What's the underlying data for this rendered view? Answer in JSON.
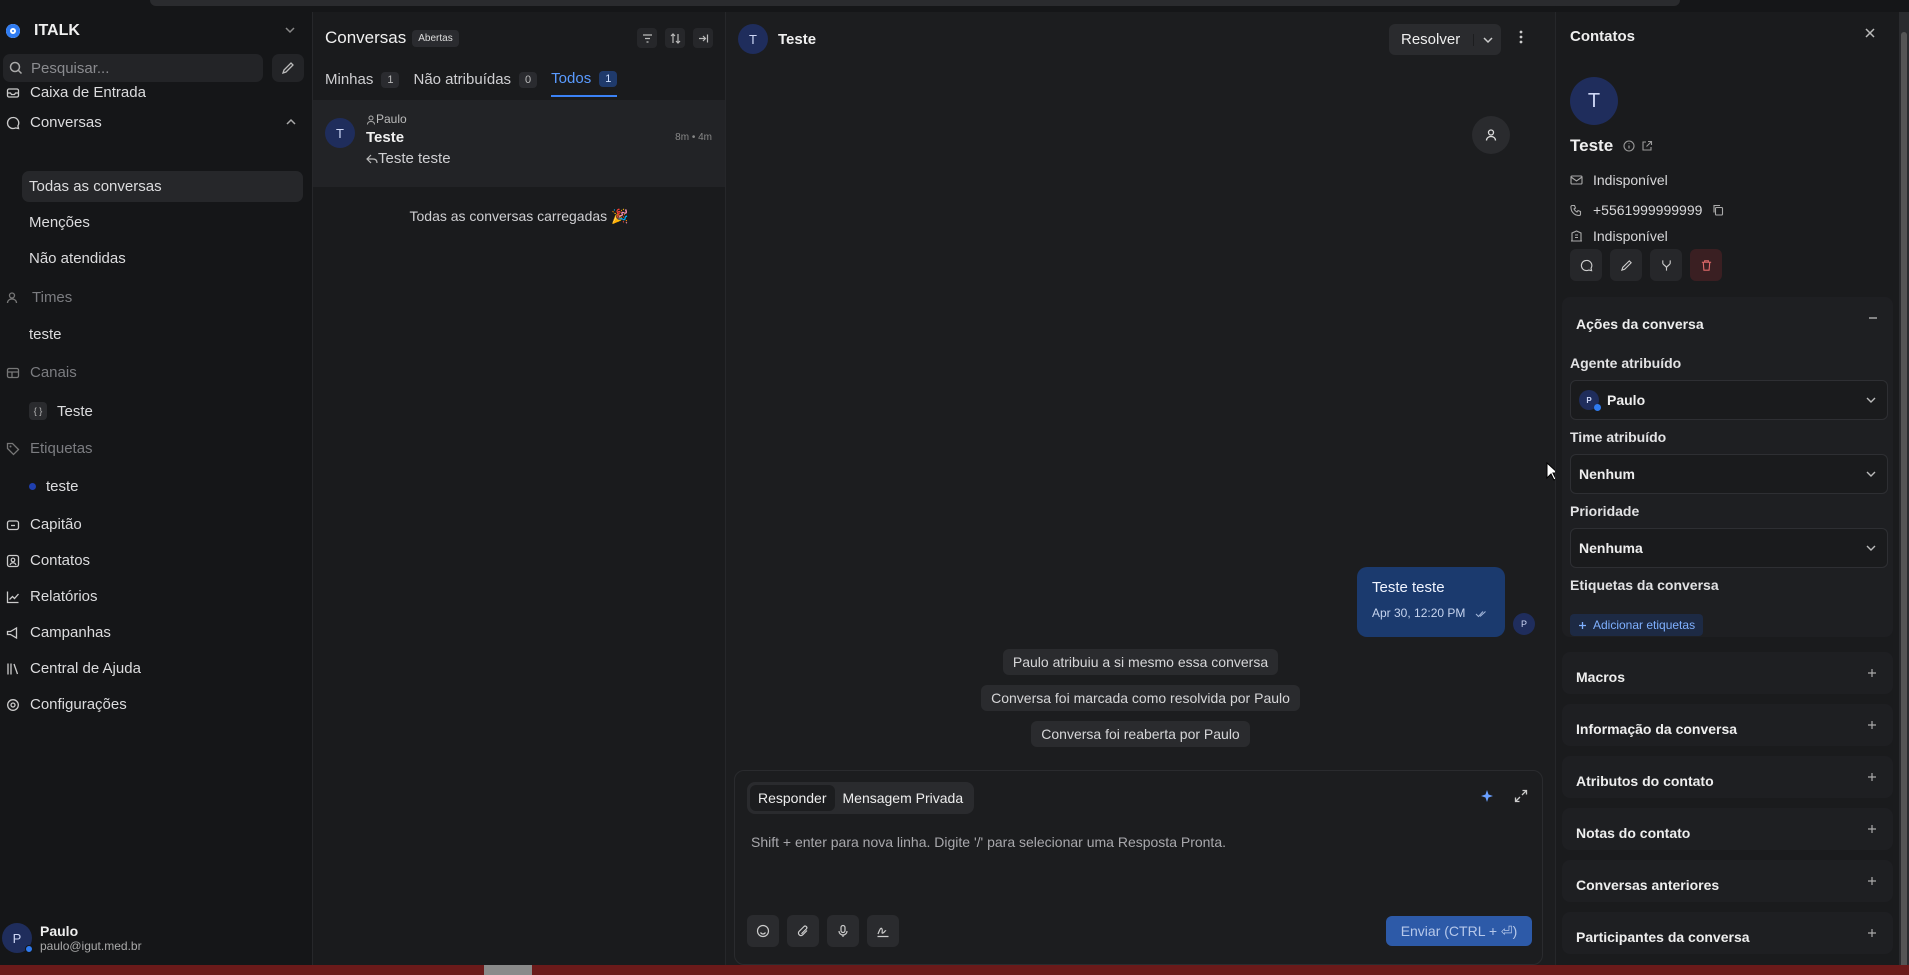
{
  "sidebar": {
    "brand": "ITALK",
    "search_placeholder": "Pesquisar...",
    "inbox": "Caixa de Entrada",
    "conversations": "Conversas",
    "all_conversations": "Todas as conversas",
    "mentions": "Menções",
    "unattended": "Não atendidas",
    "teams": "Times",
    "team_1": "teste",
    "channels": "Canais",
    "channel_1": "Teste",
    "labels": "Etiquetas",
    "label_1": "teste",
    "captain": "Capitão",
    "contacts": "Contatos",
    "reports": "Relatórios",
    "campaigns": "Campanhas",
    "help_center": "Central de Ajuda",
    "settings": "Configurações",
    "user_name": "Paulo",
    "user_email": "paulo@igut.med.br",
    "user_initial": "P"
  },
  "list": {
    "title": "Conversas",
    "status_badge": "Abertas",
    "tabs": [
      {
        "label": "Minhas",
        "count": "1"
      },
      {
        "label": "Não atribuídas",
        "count": "0"
      },
      {
        "label": "Todos",
        "count": "1"
      }
    ],
    "conv": {
      "initial": "T",
      "assignee": "Paulo",
      "title": "Teste",
      "preview": "Teste teste",
      "time": "8m • 4m"
    },
    "loaded_text": "Todas as conversas carregadas 🎉"
  },
  "main": {
    "initial": "T",
    "title": "Teste",
    "resolve": "Resolver",
    "message_text": "Teste teste",
    "message_time": "Apr 30, 12:20 PM",
    "message_avatar": "P",
    "activity": [
      "Paulo atribuiu a si mesmo essa conversa",
      "Conversa foi marcada como resolvida por Paulo",
      "Conversa foi reaberta por Paulo"
    ],
    "reply_tab": "Responder",
    "private_tab": "Mensagem Privada",
    "composer_placeholder": "Shift + enter para nova linha. Digite '/' para selecionar uma Resposta Pronta.",
    "send": "Enviar (CTRL + ⏎)"
  },
  "contact": {
    "panel_title": "Contatos",
    "initial": "T",
    "name": "Teste",
    "email": "Indisponível",
    "phone": "+5561999999999",
    "company": "Indisponível",
    "actions_title": "Ações da conversa",
    "agent_label": "Agente atribuído",
    "agent_value": "Paulo",
    "agent_initial": "P",
    "team_label": "Time atribuído",
    "team_value": "Nenhum",
    "priority_label": "Prioridade",
    "priority_value": "Nenhuma",
    "labels_label": "Etiquetas da conversa",
    "add_labels": "Adicionar etiquetas",
    "sections": [
      "Macros",
      "Informação da conversa",
      "Atributos do contato",
      "Notas do contato",
      "Conversas anteriores",
      "Participantes da conversa"
    ]
  },
  "colors": {
    "accent": "#3b82f6",
    "bubble": "#1b3a6e",
    "danger": "#3a1f22"
  }
}
